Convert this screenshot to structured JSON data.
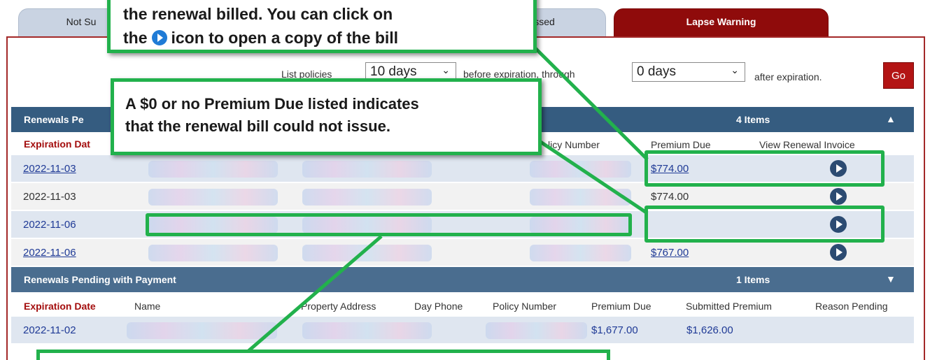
{
  "tabs": [
    {
      "label": "Not Su"
    },
    {
      "label": "ssed"
    },
    {
      "label": "Lapse Warning"
    }
  ],
  "filter": {
    "prefix": "List policies",
    "before_value": "10 days",
    "before_text": "before expiration, through",
    "after_value": "0 days",
    "after_text": "after expiration.",
    "go_label": "Go"
  },
  "section1": {
    "title": "Renewals Pe",
    "count": "4 Items",
    "columns": [
      "Expiration Dat",
      "licy Number",
      "Premium Due",
      "View Renewal Invoice"
    ],
    "rows": [
      {
        "date": "2022-11-03",
        "premium": "$774.00"
      },
      {
        "date": "2022-11-03",
        "premium": "$774.00"
      },
      {
        "date": "2022-11-06",
        "premium": ""
      },
      {
        "date": "2022-11-06",
        "premium": "$767.00"
      }
    ]
  },
  "section2": {
    "title": "Renewals Pending with Payment",
    "count": "1 Items",
    "columns": [
      "Expiration Date",
      "Name",
      "Property Address",
      "Day Phone",
      "Policy Number",
      "Premium Due",
      "Submitted Premium",
      "Reason Pending"
    ],
    "rows": [
      {
        "date": "2022-11-02",
        "premium": "$1,677.00",
        "submitted": "$1,626.00"
      }
    ]
  },
  "callouts": {
    "top_line1": "the renewal billed. You can click on",
    "top_line2a": "the",
    "top_line2b": "icon to open a copy of the bill",
    "middle_line1": "A $0 or no Premium Due listed indicates",
    "middle_line2": "that the renewal bill could not issue."
  },
  "colors": {
    "callout_border": "#22b14c",
    "section_bar": "#355c80",
    "tab_active": "#8f0b0b"
  }
}
